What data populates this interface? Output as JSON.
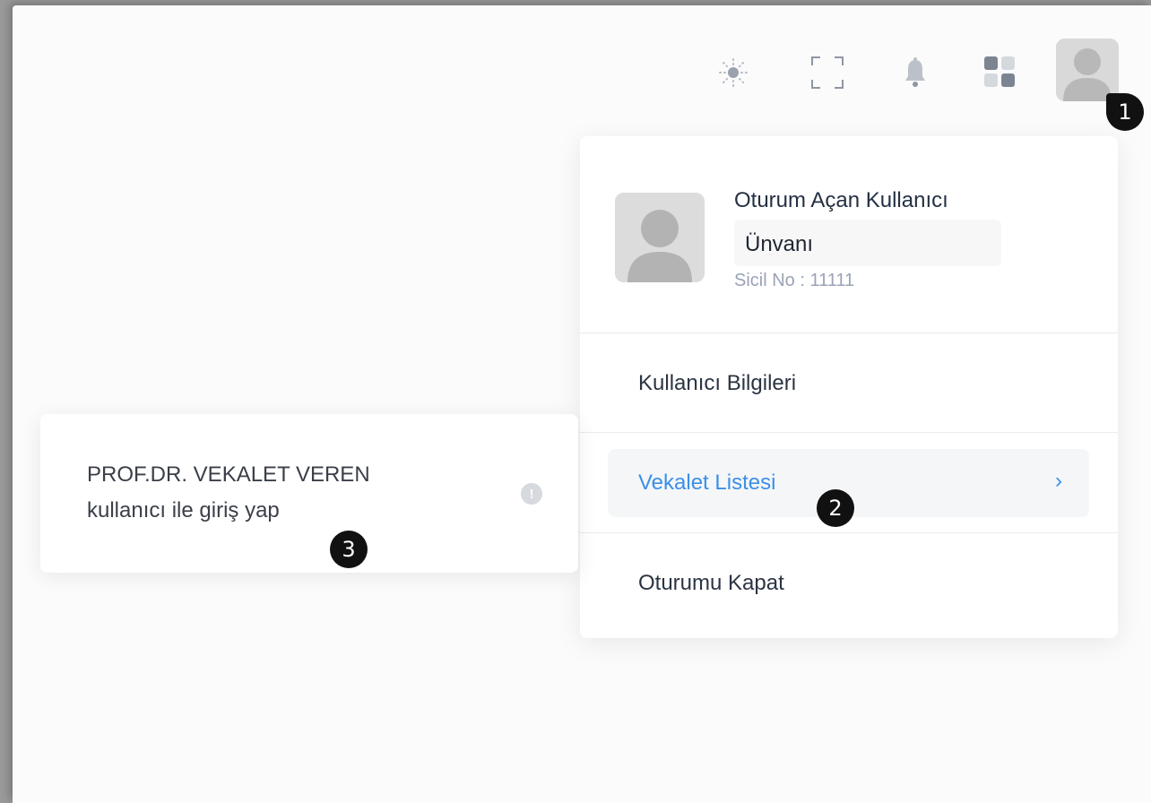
{
  "topbar": {
    "icons": [
      "sun-icon",
      "fullscreen-icon",
      "bell-icon",
      "apps-grid-icon"
    ],
    "avatar_icon": "user-avatar-icon"
  },
  "annotations": {
    "one": "1",
    "two": "2",
    "three": "3"
  },
  "profile": {
    "name": "Oturum Açan Kullanıcı",
    "title": "Ünvanı",
    "sicil": "Sicil No : 11111"
  },
  "menu": {
    "user_info": "Kullanıcı Bilgileri",
    "proxy_list": "Vekalet Listesi",
    "proxy_chevron": "›",
    "logout": "Oturumu Kapat"
  },
  "proxy_panel": {
    "line1": "PROF.DR. VEKALET VEREN",
    "line2": "kullanıcı ile giriş yap",
    "info_glyph": "!"
  },
  "colors": {
    "accent": "#3b8fe8",
    "text": "#2b3442",
    "muted": "#9aa3b5"
  }
}
